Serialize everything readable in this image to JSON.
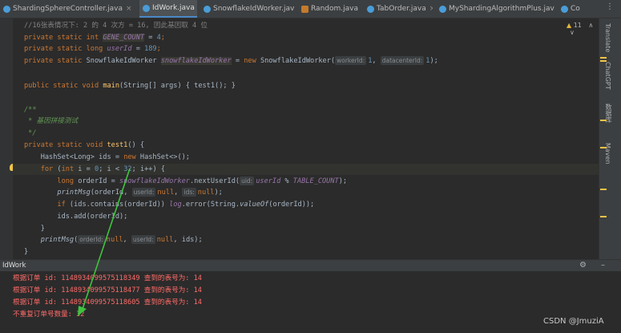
{
  "tabs": [
    {
      "label": "ShardingSphereController.java",
      "active": false
    },
    {
      "label": "IdWork.java",
      "active": true
    },
    {
      "label": "SnowflakeIdWorker.java",
      "active": false
    },
    {
      "label": "Random.java",
      "active": false
    },
    {
      "label": "TabOrder.java",
      "active": false
    },
    {
      "label": "MyShardingAlgorithmPlus.java",
      "active": false
    },
    {
      "label": "Co",
      "active": false
    }
  ],
  "tab_controls": {
    "more": "⋮"
  },
  "warnings": {
    "icon": "warning-icon",
    "count": "11",
    "up": "∧",
    "down": "∨"
  },
  "code": {
    "l1_comment": "//16张表情况下: 2 的 4 次方 = 16, 因此基因取 4 位",
    "l2_kw": "private static int ",
    "l2_field": "GENE_COUNT",
    "l2_rest": " = ",
    "l2_num": "4",
    "l2_end": ";",
    "l3_kw": "private static long ",
    "l3_field": "userId",
    "l3_rest": " = ",
    "l3_num": "189",
    "l3_end": ";",
    "l4_kw": "private static ",
    "l4_type": "SnowflakeIdWorker ",
    "l4_field": "snowflakeIdWorker",
    "l4_eq": " = ",
    "l4_new": "new ",
    "l4_ctor": "SnowflakeIdWorker(",
    "l4_hint1": "workerId:",
    "l4_num1": "1",
    "l4_comma": ", ",
    "l4_hint2": "datacenterId:",
    "l4_num2": "1",
    "l4_end": ");",
    "l6_kw": "public static void ",
    "l6_fn": "main",
    "l6_rest": "(String[] args) { test1(); }",
    "l8": "/**",
    "l9": " * 基因拼接测试",
    "l10": " */",
    "l11_kw": "private static void ",
    "l11_fn": "test1",
    "l11_rest": "() {",
    "l12_pre": "    HashSet<Long> ids = ",
    "l12_new": "new ",
    "l12_rest": "HashSet<>();",
    "l13_for": "    for ",
    "l13_a": "(",
    "l13_int": "int ",
    "l13_b": "i = ",
    "l13_n0": "0",
    "l13_c": "; i < ",
    "l13_n32": "32",
    "l13_d": "; i++) {",
    "l14_kw": "        long ",
    "l14_a": "orderId = ",
    "l14_field": "snowflakeIdWorker",
    "l14_b": ".nextUserId(",
    "l14_hint": "uid:",
    "l14_field2": "userId",
    "l14_c": " % ",
    "l14_field3": "TABLE_COUNT",
    "l14_d": ");",
    "l15_pre": "        ",
    "l15_fn": "printMsg",
    "l15_a": "(orderId, ",
    "l15_hint1": "userId:",
    "l15_null1": "null",
    "l15_b": ", ",
    "l15_hint2": "ids:",
    "l15_null2": "null",
    "l15_c": ");",
    "l16_kw": "        if ",
    "l16_a": "(ids.contains(orderId)) ",
    "l16_log": "log",
    "l16_b": ".error(String.",
    "l16_fn": "valueOf",
    "l16_c": "(orderId));",
    "l17": "        ids.add(orderId);",
    "l18": "    }",
    "l19_pre": "    ",
    "l19_fn": "printMsg",
    "l19_a": "(",
    "l19_hint1": "orderId:",
    "l19_null1": "null",
    "l19_b": ", ",
    "l19_hint2": "userId:",
    "l19_null2": "null",
    "l19_c": ", ids);",
    "l20": "}"
  },
  "right_sidebar": {
    "items": [
      "Translate",
      "ChatGPT",
      "数据库",
      "Maven"
    ]
  },
  "run_panel": {
    "title": "IdWork",
    "settings_icon": "gear-icon",
    "minimize_icon": "minimize-icon"
  },
  "console": {
    "lines": [
      "根据订单 id: 1148934099575118349 查到的表号为: 14",
      "根据订单 id: 1148934099575118477 查到的表号为: 14",
      "根据订单 id: 1148934099575118605 查到的表号为: 14",
      "不重复订单号数量: 32"
    ]
  },
  "watermark": "CSDN @JmuziA",
  "colors": {
    "background": "#2b2b2b",
    "keyword": "#cc7832",
    "field": "#9876aa",
    "number": "#6897bb",
    "javadoc": "#629755",
    "console_error": "#ff6b68",
    "arrow": "#3ec43e"
  }
}
